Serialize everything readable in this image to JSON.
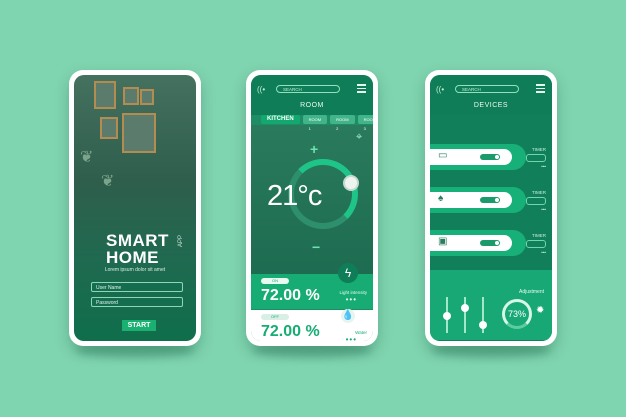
{
  "phone1": {
    "title_line1": "SMART",
    "title_line2": "HOME",
    "title_suffix": "APP",
    "subtitle": "Lorem ipsum dolor sit amet",
    "username_placeholder": "User Name",
    "password_placeholder": "Password",
    "start_label": "START"
  },
  "phone2": {
    "search_label": "SEARCH",
    "title": "ROOM",
    "tabs": [
      "KITCHEN",
      "ROOM 1",
      "ROOM 2",
      "ROOM 3"
    ],
    "temperature": "21°c",
    "light_toggle": "ON",
    "light_value": "72.00 %",
    "light_label": "Light intensity",
    "water_toggle": "OFF",
    "water_value": "72.00 %",
    "water_label": "Water",
    "dots": "•••"
  },
  "phone3": {
    "search_label": "SEARCH",
    "title": "DEVICES",
    "devices": [
      {
        "icon": "air-conditioner-icon",
        "timer": "TIMER"
      },
      {
        "icon": "lamp-icon",
        "timer": "TIMER"
      },
      {
        "icon": "monitor-icon",
        "timer": "TIMER"
      }
    ],
    "adjustment_label": "Adjustment",
    "adjustment_value": "73%",
    "slider_levels": [
      0.45,
      0.75,
      0.15
    ]
  },
  "colors": {
    "background": "#7fd5b0",
    "primary": "#16ac74",
    "dark": "#0f7d57"
  }
}
